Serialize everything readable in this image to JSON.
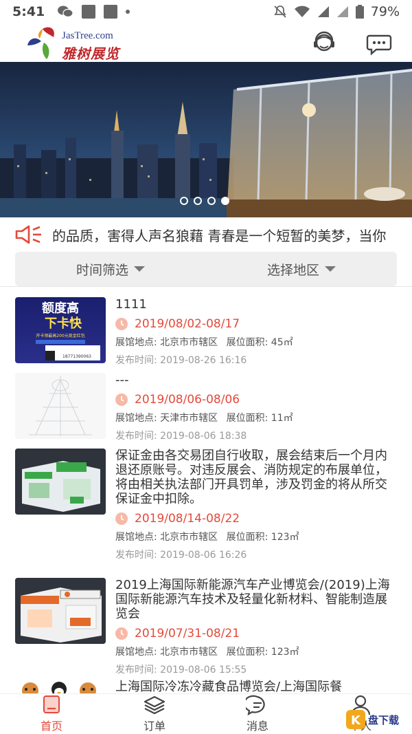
{
  "status_bar": {
    "time": "5:41",
    "battery": "79%"
  },
  "header": {
    "logo_en": "JasTree.com",
    "logo_cn": "雅树展览",
    "icons": [
      "customer-service-icon",
      "message-icon"
    ]
  },
  "banner": {
    "slide_count": 4,
    "active_slide": 4
  },
  "notice": {
    "text": "的品质，害得人声名狼藉   青春是一个短暂的美梦，当你"
  },
  "filter": {
    "time_label": "时间筛选",
    "region_label": "选择地区"
  },
  "items": [
    {
      "title": "1111",
      "date": "2019/08/02-08/17",
      "venue_label": "展馆地点:",
      "venue": "北京市市辖区",
      "area_label": "展位面积:",
      "area": "45㎡",
      "publish_label": "发布时间:",
      "publish": "2019-08-26 16:16"
    },
    {
      "title": "---",
      "date": "2019/08/06-08/06",
      "venue_label": "展馆地点:",
      "venue": "天津市市辖区",
      "area_label": "展位面积:",
      "area": "11㎡",
      "publish_label": "发布时间:",
      "publish": "2019-08-06 18:38"
    },
    {
      "title": "保证金由各交易团自行收取，展会结束后一个月内退还原账号。对违反展会、消防规定的布展单位，将由相关执法部门开具罚单，涉及罚金的将从所交保证金中扣除。",
      "date": "2019/08/14-08/22",
      "venue_label": "展馆地点:",
      "venue": "北京市市辖区",
      "area_label": "展位面积:",
      "area": "123㎡",
      "publish_label": "发布时间:",
      "publish": "2019-08-06 16:26"
    },
    {
      "title": "2019上海国际新能源汽车产业博览会/(2019)上海国际新能源汽车技术及轻量化新材料、智能制造展览会",
      "date": "2019/07/31-08/21",
      "venue_label": "展馆地点:",
      "venue": "北京市市辖区",
      "area_label": "展位面积:",
      "area": "123㎡",
      "publish_label": "发布时间:",
      "publish": "2019-08-06 15:55"
    },
    {
      "title": "上海国际冷冻冷藏食品博览会/上海国际餐"
    }
  ],
  "thumb_text": {
    "item1_big1": "额度高",
    "item1_big2": "下卡快",
    "item1_small": "开卡领最高200元现金红包",
    "item1_phone": "18771390063"
  },
  "tabs": [
    {
      "label": "首页",
      "active": true
    },
    {
      "label": "订单",
      "active": false
    },
    {
      "label": "消息",
      "active": false
    },
    {
      "label": "个人",
      "active": false
    }
  ],
  "watermark": {
    "text": "盘下载"
  },
  "colors": {
    "accent": "#e24a3b",
    "filter_bg": "#efefef"
  }
}
